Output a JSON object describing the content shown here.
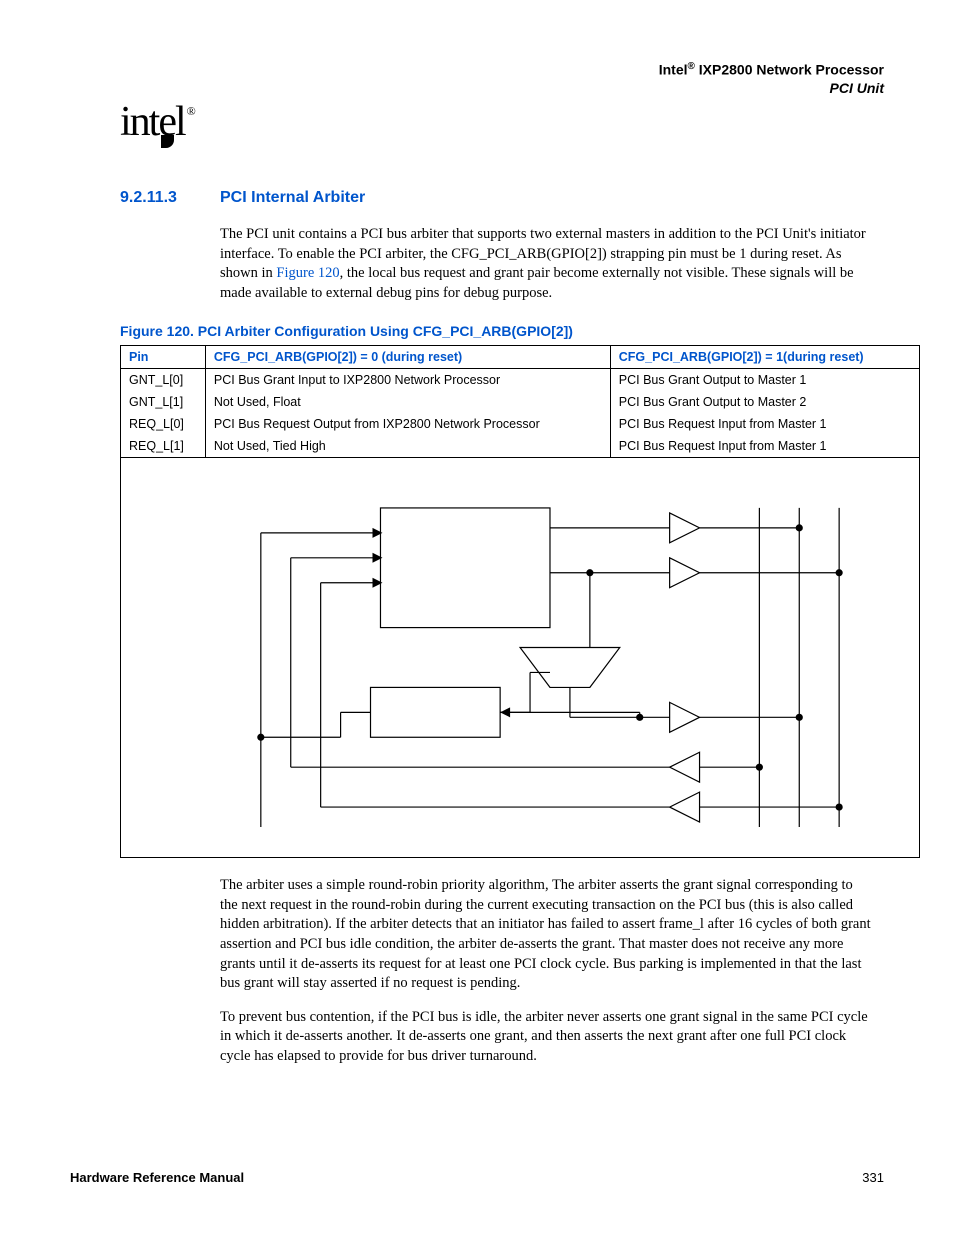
{
  "header": {
    "line1_prefix": "Intel",
    "line1_reg": "®",
    "line1_suffix": " IXP2800 Network Processor",
    "line2": "PCI Unit"
  },
  "logo": {
    "text": "intel",
    "reg": "®"
  },
  "section": {
    "num": "9.2.11.3",
    "title": "PCI Internal Arbiter"
  },
  "para1_a": "The PCI unit contains a PCI bus arbiter that supports two external masters in addition to the PCI Unit's initiator interface. To enable the PCI arbiter, the CFG_PCI_ARB(GPIO[2]) strapping pin must be 1 during reset. As shown in ",
  "para1_link": "Figure 120",
  "para1_b": ", the local bus request and grant pair become externally not visible. These signals will be made available to external debug pins for debug purpose.",
  "figure_caption": "Figure 120. PCI Arbiter Configuration Using CFG_PCI_ARB(GPIO[2])",
  "table": {
    "headers": [
      "Pin",
      "CFG_PCI_ARB(GPIO[2]) = 0 (during reset)",
      "CFG_PCI_ARB(GPIO[2]) = 1(during reset)"
    ],
    "rows": [
      [
        "GNT_L[0]",
        "PCI Bus Grant Input to IXP2800 Network Processor",
        "PCI Bus Grant Output to Master 1"
      ],
      [
        "GNT_L[1]",
        "Not Used, Float",
        "PCI Bus Grant Output to Master 2"
      ],
      [
        "REQ_L[0]",
        "PCI Bus Request Output from IXP2800 Network Processor",
        "PCI Bus Request Input from Master 1"
      ],
      [
        "REQ_L[1]",
        "Not Used, Tied High",
        "PCI Bus Request Input from Master 1"
      ]
    ]
  },
  "para2": "The arbiter uses a simple round-robin priority algorithm, The arbiter asserts the grant signal corresponding to the next request in the round-robin during the current executing transaction on the PCI bus (this is also called hidden arbitration). If the arbiter detects that an initiator has failed to assert frame_l after 16 cycles of both grant assertion and PCI bus idle condition, the arbiter de-asserts the grant. That master does not receive any more grants until it de-asserts its request for at least one PCI clock cycle. Bus parking is implemented in that the last bus grant will stay asserted if no request is pending.",
  "para3": "To prevent bus contention, if the PCI bus is idle, the arbiter never asserts one grant signal in the same PCI cycle in which it de-asserts another. It de-asserts one grant, and then asserts the next grant after one full PCI clock cycle has elapsed to provide for bus driver turnaround.",
  "footer": {
    "left": "Hardware Reference Manual",
    "right": "331"
  }
}
